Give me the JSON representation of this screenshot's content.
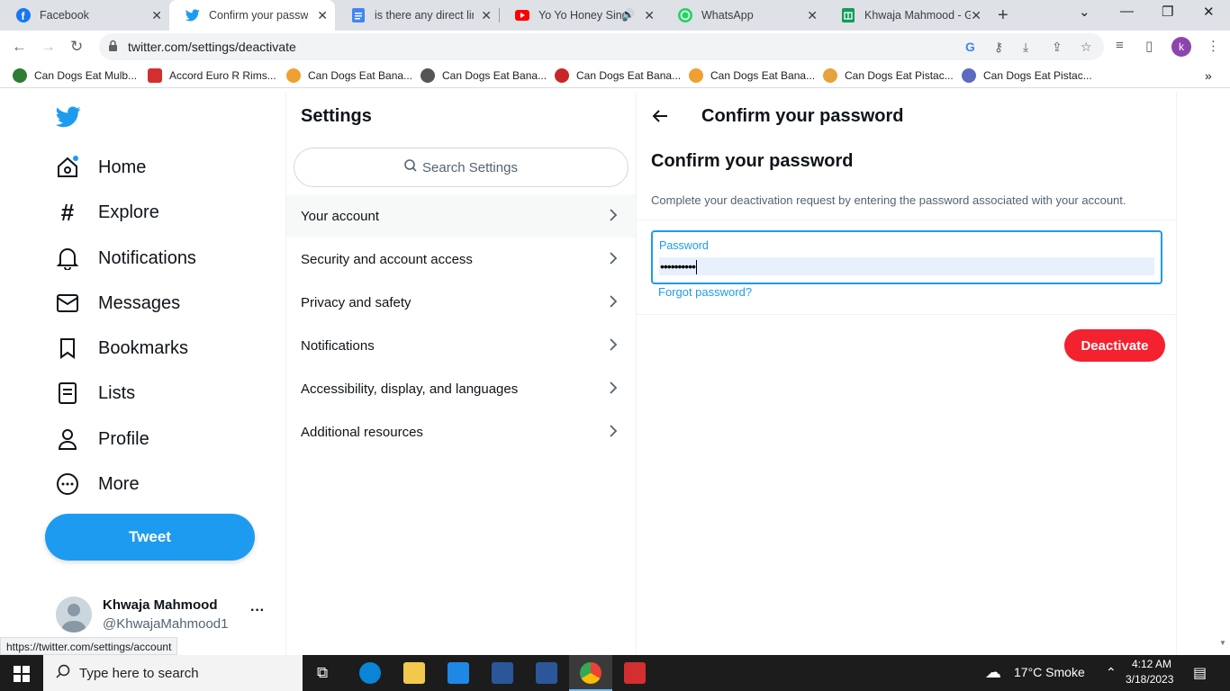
{
  "browser": {
    "tabs": [
      {
        "title": "Facebook",
        "icon": "facebook-icon",
        "active": false
      },
      {
        "title": "Confirm your password",
        "icon": "twitter-icon",
        "active": true
      },
      {
        "title": "is there any direct link",
        "icon": "docs-icon",
        "active": false
      },
      {
        "title": "Yo Yo Honey Singh",
        "icon": "youtube-icon",
        "active": false
      },
      {
        "title": "WhatsApp",
        "icon": "whatsapp-icon",
        "active": false
      },
      {
        "title": "Khwaja Mahmood - G",
        "icon": "sheets-icon",
        "active": false
      }
    ],
    "url": "twitter.com/settings/deactivate",
    "profile_initial": "k",
    "bookmarks": [
      "Can Dogs Eat Mulb...",
      "Accord Euro R Rims...",
      "Can Dogs Eat Bana...",
      "Can Dogs Eat Bana...",
      "Can Dogs Eat Bana...",
      "Can Dogs Eat Bana...",
      "Can Dogs Eat Pistac...",
      "Can Dogs Eat Pistac..."
    ],
    "status_url": "https://twitter.com/settings/account"
  },
  "nav": {
    "items": [
      "Home",
      "Explore",
      "Notifications",
      "Messages",
      "Bookmarks",
      "Lists",
      "Profile",
      "More"
    ],
    "tweet_label": "Tweet",
    "user": {
      "name": "Khwaja Mahmood",
      "handle": "@KhwajaMahmood1"
    }
  },
  "settings": {
    "title": "Settings",
    "search_placeholder": "Search Settings",
    "items": [
      "Your account",
      "Security and account access",
      "Privacy and safety",
      "Notifications",
      "Accessibility, display, and languages",
      "Additional resources"
    ]
  },
  "confirm": {
    "header": "Confirm your password",
    "title": "Confirm your password",
    "description": "Complete your deactivation request by entering the password associated with your account.",
    "password_label": "Password",
    "password_value": "••••••••••",
    "forgot": "Forgot password?",
    "deactivate": "Deactivate"
  },
  "taskbar": {
    "search_placeholder": "Type here to search",
    "weather": "17°C  Smoke",
    "time": "4:12 AM",
    "date": "3/18/2023"
  },
  "colors": {
    "twitter_blue": "#1d9bf0",
    "danger": "#f4212e"
  }
}
